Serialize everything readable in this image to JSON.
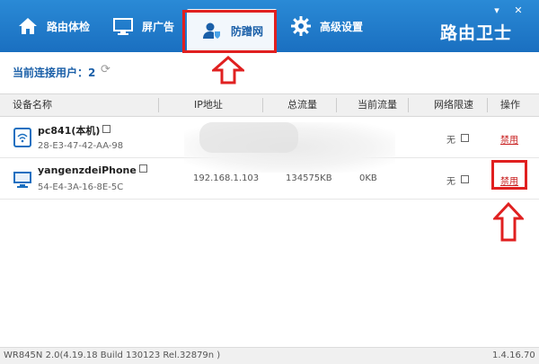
{
  "window_controls": {
    "minimize": "▾",
    "close": "✕"
  },
  "tabs": [
    {
      "label": "路由体检",
      "icon": "home-icon"
    },
    {
      "label": "屏广告",
      "icon": "monitor-icon"
    },
    {
      "label": "防蹭网",
      "icon": "user-shield-icon",
      "active": true
    },
    {
      "label": "高级设置",
      "icon": "gear-icon"
    }
  ],
  "brand": "路由卫士",
  "connected_users": {
    "label": "当前连接用户：2"
  },
  "table": {
    "headers": [
      "设备名称",
      "IP地址",
      "总流量",
      "当前流量",
      "网络限速",
      "操作"
    ],
    "rows": [
      {
        "name": "pc841(本机)",
        "mac": "28-E3-47-42-AA-98",
        "ip": "",
        "total": "",
        "current": "",
        "limit": "无",
        "action": "禁用",
        "icon": "tablet-wifi-icon"
      },
      {
        "name": "yangenzdeiPhone",
        "mac": "54-E4-3A-16-8E-5C",
        "ip": "192.168.1.103",
        "total": "134575KB",
        "current": "0KB",
        "limit": "无",
        "action": "禁用",
        "icon": "monitor-icon"
      }
    ]
  },
  "footer": {
    "firmware": "WR845N 2.0(4.19.18 Build 130123 Rel.32879n )",
    "version": "1.4.16.70"
  },
  "colors": {
    "topbar": "#1a6fc0",
    "highlight": "#e02020",
    "ban": "#c81e1e"
  }
}
